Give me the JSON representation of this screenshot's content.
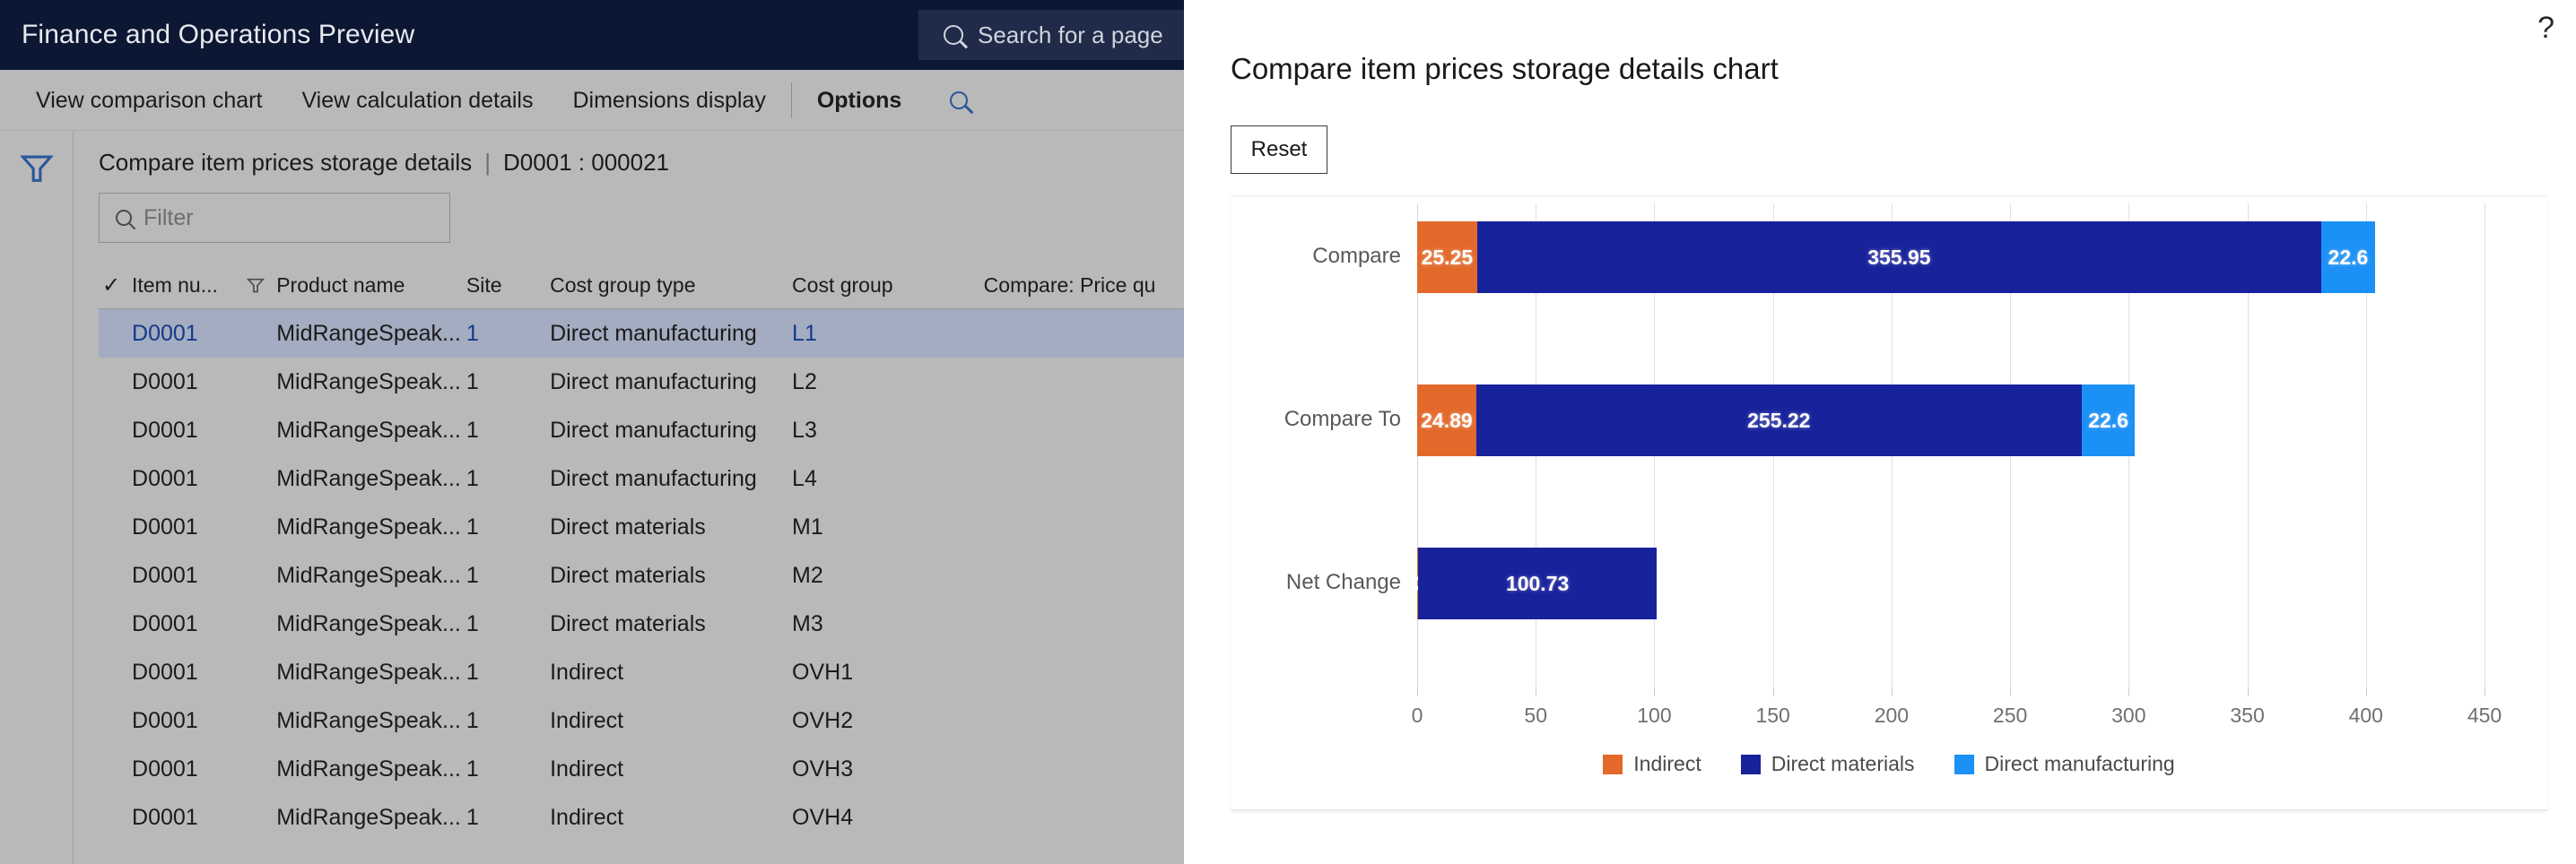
{
  "app": {
    "brand": "Finance and Operations Preview",
    "search": {
      "placeholder": "Search for a page",
      "icon": "search-icon"
    }
  },
  "action_pane": {
    "items": [
      {
        "label": "View comparison chart",
        "bold": false
      },
      {
        "label": "View calculation details",
        "bold": false
      },
      {
        "label": "Dimensions display",
        "bold": false
      },
      {
        "label": "Options",
        "bold": true
      }
    ],
    "search_icon": "search-icon"
  },
  "left_rail": {
    "filter_icon": "filter-funnel-icon"
  },
  "page": {
    "caption": "Compare item prices storage details",
    "separator": "|",
    "record": "D0001 : 000021",
    "filter": {
      "placeholder": "Filter",
      "value": "",
      "icon": "search-icon"
    }
  },
  "grid": {
    "columns": [
      "Item nu...",
      "Product name",
      "Site",
      "Cost group type",
      "Cost group",
      "Compare: Price qu"
    ],
    "select_all_icon": "checkmark-icon",
    "column_filter_icon": "filter-funnel-icon",
    "rows": [
      {
        "item": "D0001",
        "product": "MidRangeSpeak...",
        "site": "1",
        "cost_group_type": "Direct manufacturing",
        "cost_group": "L1",
        "compare": "",
        "selected": true
      },
      {
        "item": "D0001",
        "product": "MidRangeSpeak...",
        "site": "1",
        "cost_group_type": "Direct manufacturing",
        "cost_group": "L2",
        "compare": "",
        "selected": false
      },
      {
        "item": "D0001",
        "product": "MidRangeSpeak...",
        "site": "1",
        "cost_group_type": "Direct manufacturing",
        "cost_group": "L3",
        "compare": "",
        "selected": false
      },
      {
        "item": "D0001",
        "product": "MidRangeSpeak...",
        "site": "1",
        "cost_group_type": "Direct manufacturing",
        "cost_group": "L4",
        "compare": "",
        "selected": false
      },
      {
        "item": "D0001",
        "product": "MidRangeSpeak...",
        "site": "1",
        "cost_group_type": "Direct materials",
        "cost_group": "M1",
        "compare": "",
        "selected": false
      },
      {
        "item": "D0001",
        "product": "MidRangeSpeak...",
        "site": "1",
        "cost_group_type": "Direct materials",
        "cost_group": "M2",
        "compare": "",
        "selected": false
      },
      {
        "item": "D0001",
        "product": "MidRangeSpeak...",
        "site": "1",
        "cost_group_type": "Direct materials",
        "cost_group": "M3",
        "compare": "",
        "selected": false
      },
      {
        "item": "D0001",
        "product": "MidRangeSpeak...",
        "site": "1",
        "cost_group_type": "Indirect",
        "cost_group": "OVH1",
        "compare": "",
        "selected": false
      },
      {
        "item": "D0001",
        "product": "MidRangeSpeak...",
        "site": "1",
        "cost_group_type": "Indirect",
        "cost_group": "OVH2",
        "compare": "",
        "selected": false
      },
      {
        "item": "D0001",
        "product": "MidRangeSpeak...",
        "site": "1",
        "cost_group_type": "Indirect",
        "cost_group": "OVH3",
        "compare": "",
        "selected": false
      },
      {
        "item": "D0001",
        "product": "MidRangeSpeak...",
        "site": "1",
        "cost_group_type": "Indirect",
        "cost_group": "OVH4",
        "compare": "",
        "selected": false
      }
    ]
  },
  "chart_pane": {
    "help_icon": "help-question-icon",
    "title": "Compare item prices storage details chart",
    "reset_label": "Reset"
  },
  "chart_data": {
    "type": "bar",
    "orientation": "horizontal",
    "stacked": true,
    "title": "Compare item prices storage details chart",
    "xlabel": "",
    "ylabel": "",
    "xlim": [
      0,
      450
    ],
    "xticks": [
      0,
      50,
      100,
      150,
      200,
      250,
      300,
      350,
      400,
      450
    ],
    "grid": true,
    "legend_position": "bottom",
    "categories": [
      "Compare",
      "Compare To",
      "Net Change"
    ],
    "series": [
      {
        "name": "Indirect",
        "color": "#E3692B",
        "values": [
          25.25,
          24.89,
          0.36
        ]
      },
      {
        "name": "Direct materials",
        "color": "#18229B",
        "values": [
          355.95,
          255.22,
          100.73
        ]
      },
      {
        "name": "Direct manufacturing",
        "color": "#1B90F5",
        "values": [
          22.6,
          22.6,
          0
        ]
      }
    ],
    "labels": {
      "Compare": [
        "25.25",
        "355.95",
        "22.6"
      ],
      "Compare To": [
        "24.89",
        "255.22",
        "22.6"
      ],
      "Net Change": [
        "0.36",
        "100.73",
        "0"
      ]
    }
  },
  "colors": {
    "navy_header": "#0b1733",
    "app_gray": "#b9b9b9",
    "row_selected": "#a3acc0",
    "link_blue": "#2b579a",
    "indirect": "#E3692B",
    "direct_materials": "#18229B",
    "direct_manufacturing": "#1B90F5"
  }
}
